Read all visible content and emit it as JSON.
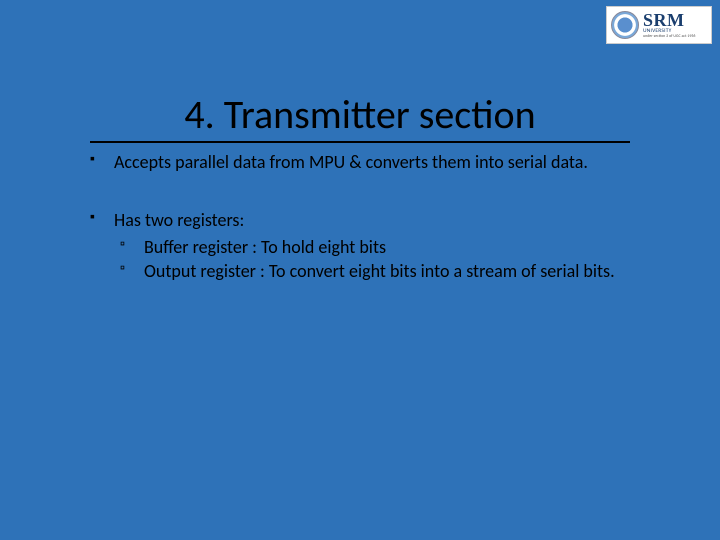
{
  "logo": {
    "main": "SRM",
    "sub": "UNIVERSITY",
    "tag": "under section 3 of UGC act 1956"
  },
  "title": "4. Transmitter section",
  "bullets": [
    {
      "text": "Accepts parallel data from MPU & converts them into serial data.",
      "children": []
    },
    {
      "text": "Has two registers:",
      "children": [
        {
          "text": "Buffer register : To hold eight bits"
        },
        {
          "text": "Output register : To convert eight bits into a stream of serial bits."
        }
      ]
    }
  ]
}
